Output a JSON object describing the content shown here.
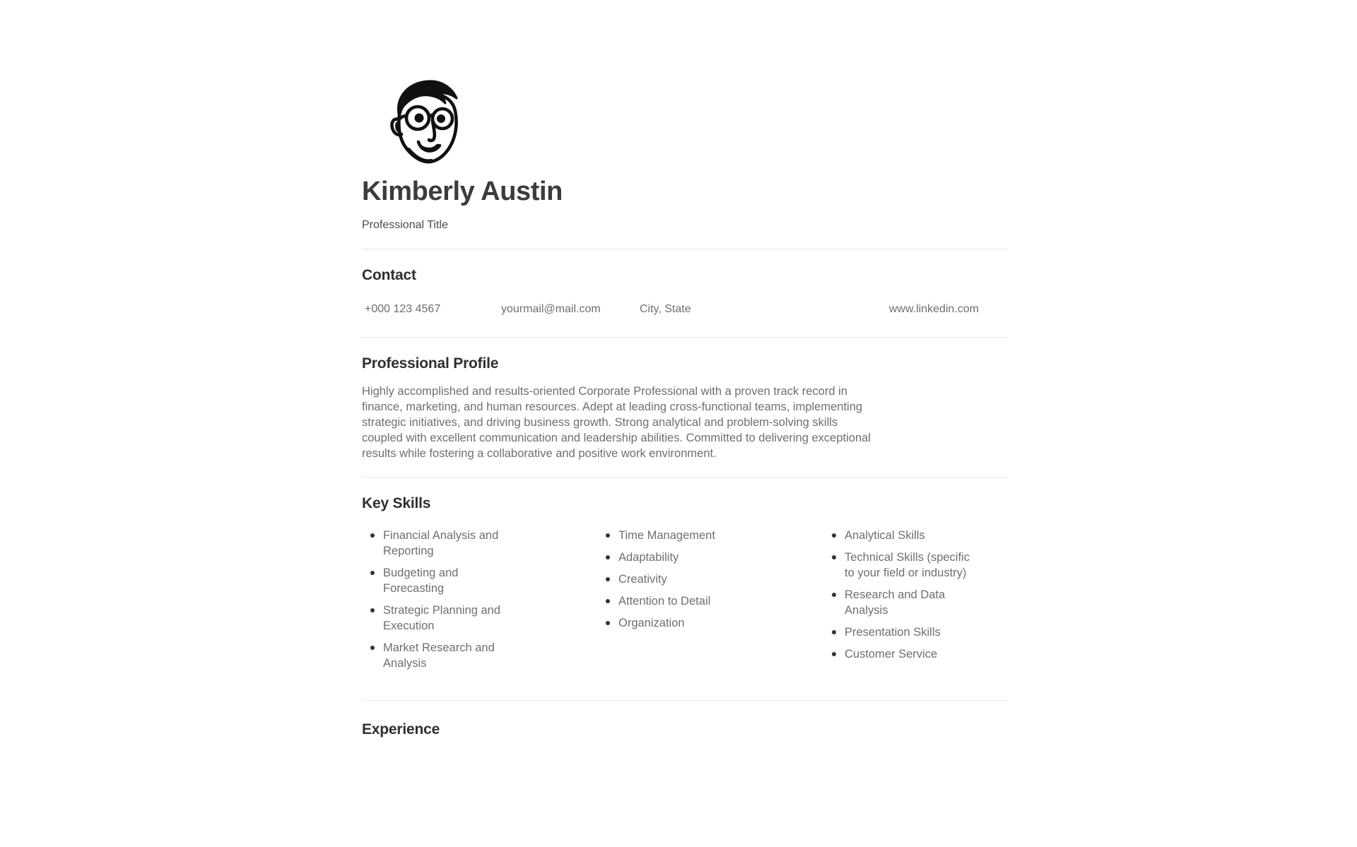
{
  "document": {
    "type": "resume",
    "background_color": "#ffffff",
    "text_color_heading": "#2f2f2f",
    "text_color_body": "#6f6f6f",
    "divider_color": "#e8e8e8"
  },
  "header": {
    "avatar_icon": "person-face-illustration-icon",
    "name": "Kimberly Austin",
    "job_title": "Professional Title"
  },
  "contact": {
    "heading": "Contact",
    "items": [
      {
        "icon": "phone-icon",
        "value": "+000 123 4567"
      },
      {
        "icon": "email-icon",
        "value": "yourmail@mail.com"
      },
      {
        "icon": "location-icon",
        "value": "City, State"
      },
      {
        "icon": "link-icon",
        "value": "www.linkedin.com"
      }
    ]
  },
  "profile": {
    "heading": "Professional Profile",
    "body": "Highly accomplished and results-oriented Corporate Professional with a proven track record in finance, marketing, and human resources. Adept at leading cross-functional teams, implementing strategic initiatives, and driving business growth. Strong analytical and problem-solving skills coupled with excellent communication and leadership abilities. Committed to delivering exceptional results while fostering a collaborative and positive work environment."
  },
  "skills": {
    "heading": "Key Skills",
    "columns": [
      {
        "items": [
          "Financial Analysis and Reporting",
          "Budgeting and Forecasting",
          "Strategic Planning and Execution",
          "Market Research and Analysis"
        ]
      },
      {
        "items": [
          "Time Management",
          "Adaptability",
          "Creativity",
          "Attention to Detail",
          "Organization"
        ]
      },
      {
        "items": [
          "Analytical Skills",
          "Technical Skills (specific to your field or industry)",
          "Research and Data Analysis",
          "Presentation Skills",
          "Customer Service"
        ]
      }
    ]
  },
  "experience": {
    "heading": "Experience"
  }
}
